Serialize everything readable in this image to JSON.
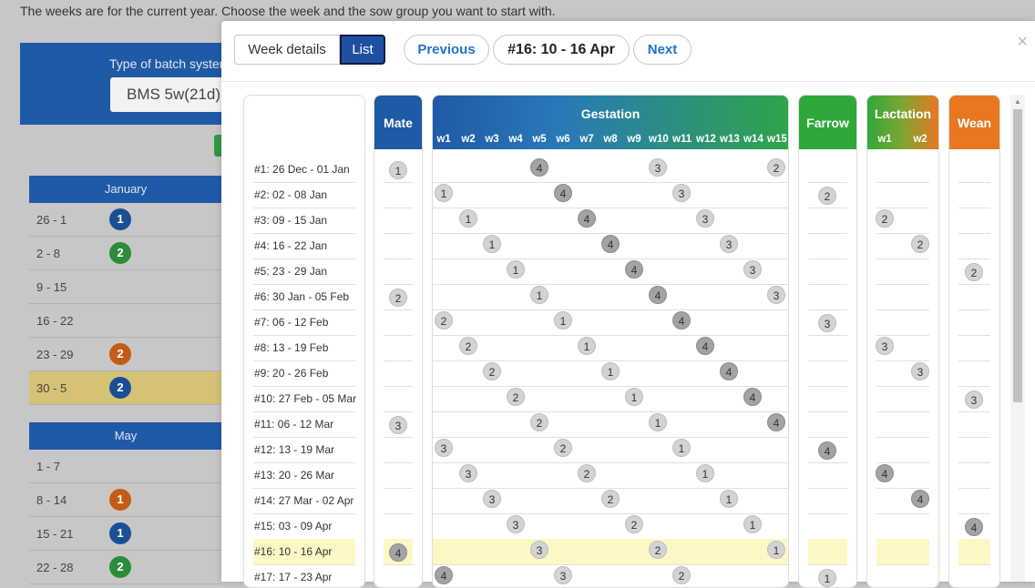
{
  "background": {
    "intro": "The weeks are for the current year. Choose the week and the sow group you want to start with.",
    "batch_label": "Type of batch system",
    "batch_value": "BMS 5w(21d)",
    "months": [
      {
        "name": "January",
        "rows": [
          {
            "range": "26 - 1",
            "group": "1",
            "color": "#1a4f96"
          },
          {
            "range": "2 - 8",
            "group": "2",
            "color": "#2e8b3a"
          },
          {
            "range": "9 - 15",
            "group": ""
          },
          {
            "range": "16 - 22",
            "group": ""
          },
          {
            "range": "23 - 29",
            "group": "2",
            "color": "#c45c18"
          },
          {
            "range": "30 - 5",
            "group": "2",
            "color": "#1a4f96",
            "highlight": true
          }
        ]
      },
      {
        "name": "May",
        "rows": [
          {
            "range": "1 - 7",
            "group": ""
          },
          {
            "range": "8 - 14",
            "group": "1",
            "color": "#c45c18"
          },
          {
            "range": "15 - 21",
            "group": "1",
            "color": "#1a4f96"
          },
          {
            "range": "22 - 28",
            "group": "2",
            "color": "#2e8b3a"
          }
        ]
      }
    ]
  },
  "modal": {
    "tab_week_details": "Week details",
    "tab_list": "List",
    "prev_label": "Previous",
    "current_week": "#16: 10 - 16 Apr",
    "next_label": "Next",
    "close_label": "×",
    "colors": {
      "mate": "#1f5aa6",
      "farrow": "#2fa83a",
      "wean": "#e87722",
      "highlight": "#fcf8c6"
    },
    "headers": {
      "mate": "Mate",
      "gestation": "Gestation",
      "gestation_weeks": [
        "w1",
        "w2",
        "w3",
        "w4",
        "w5",
        "w6",
        "w7",
        "w8",
        "w9",
        "w10",
        "w11",
        "w12",
        "w13",
        "w14",
        "w15"
      ],
      "farrow": "Farrow",
      "lactation": "Lactation",
      "lactation_weeks": [
        "w1",
        "w2"
      ],
      "wean": "Wean"
    },
    "rows": [
      {
        "week": "#1: 26 Dec - 01 Jan",
        "mate": "1",
        "gest": {
          "5": "4",
          "10": "3",
          "15": "2"
        }
      },
      {
        "week": "#2: 02 - 08 Jan",
        "gest": {
          "1": "1",
          "6": "4",
          "11": "3"
        },
        "farrow": "2"
      },
      {
        "week": "#3: 09 - 15 Jan",
        "gest": {
          "2": "1",
          "7": "4",
          "12": "3"
        },
        "lact": {
          "1": "2"
        }
      },
      {
        "week": "#4: 16 - 22 Jan",
        "gest": {
          "3": "1",
          "8": "4",
          "13": "3"
        },
        "lact": {
          "2": "2"
        }
      },
      {
        "week": "#5: 23 - 29 Jan",
        "gest": {
          "4": "1",
          "9": "4",
          "14": "3"
        },
        "wean": "2"
      },
      {
        "week": "#6: 30 Jan - 05 Feb",
        "mate": "2",
        "gest": {
          "5": "1",
          "10": "4",
          "15": "3"
        }
      },
      {
        "week": "#7: 06 - 12 Feb",
        "gest": {
          "1": "2",
          "6": "1",
          "11": "4"
        },
        "farrow": "3"
      },
      {
        "week": "#8: 13 - 19 Feb",
        "gest": {
          "2": "2",
          "7": "1",
          "12": "4"
        },
        "lact": {
          "1": "3"
        }
      },
      {
        "week": "#9: 20 - 26 Feb",
        "gest": {
          "3": "2",
          "8": "1",
          "13": "4"
        },
        "lact": {
          "2": "3"
        }
      },
      {
        "week": "#10: 27 Feb - 05 Mar",
        "gest": {
          "4": "2",
          "9": "1",
          "14": "4"
        },
        "wean": "3"
      },
      {
        "week": "#11: 06 - 12 Mar",
        "mate": "3",
        "gest": {
          "5": "2",
          "10": "1",
          "15": "4"
        }
      },
      {
        "week": "#12: 13 - 19 Mar",
        "gest": {
          "1": "3",
          "6": "2",
          "11": "1"
        },
        "farrow": "4"
      },
      {
        "week": "#13: 20 - 26 Mar",
        "gest": {
          "2": "3",
          "7": "2",
          "12": "1"
        },
        "lact": {
          "1": "4"
        }
      },
      {
        "week": "#14: 27 Mar - 02 Apr",
        "gest": {
          "3": "3",
          "8": "2",
          "13": "1"
        },
        "lact": {
          "2": "4"
        }
      },
      {
        "week": "#15: 03 - 09 Apr",
        "gest": {
          "4": "3",
          "9": "2",
          "14": "1"
        },
        "wean": "4"
      },
      {
        "week": "#16: 10 - 16 Apr",
        "mate": "4",
        "gest": {
          "5": "3",
          "10": "2",
          "15": "1"
        },
        "highlight": true
      },
      {
        "week": "#17: 17 - 23 Apr",
        "gest": {
          "1": "4",
          "6": "3",
          "11": "2"
        },
        "farrow": "1"
      }
    ]
  }
}
